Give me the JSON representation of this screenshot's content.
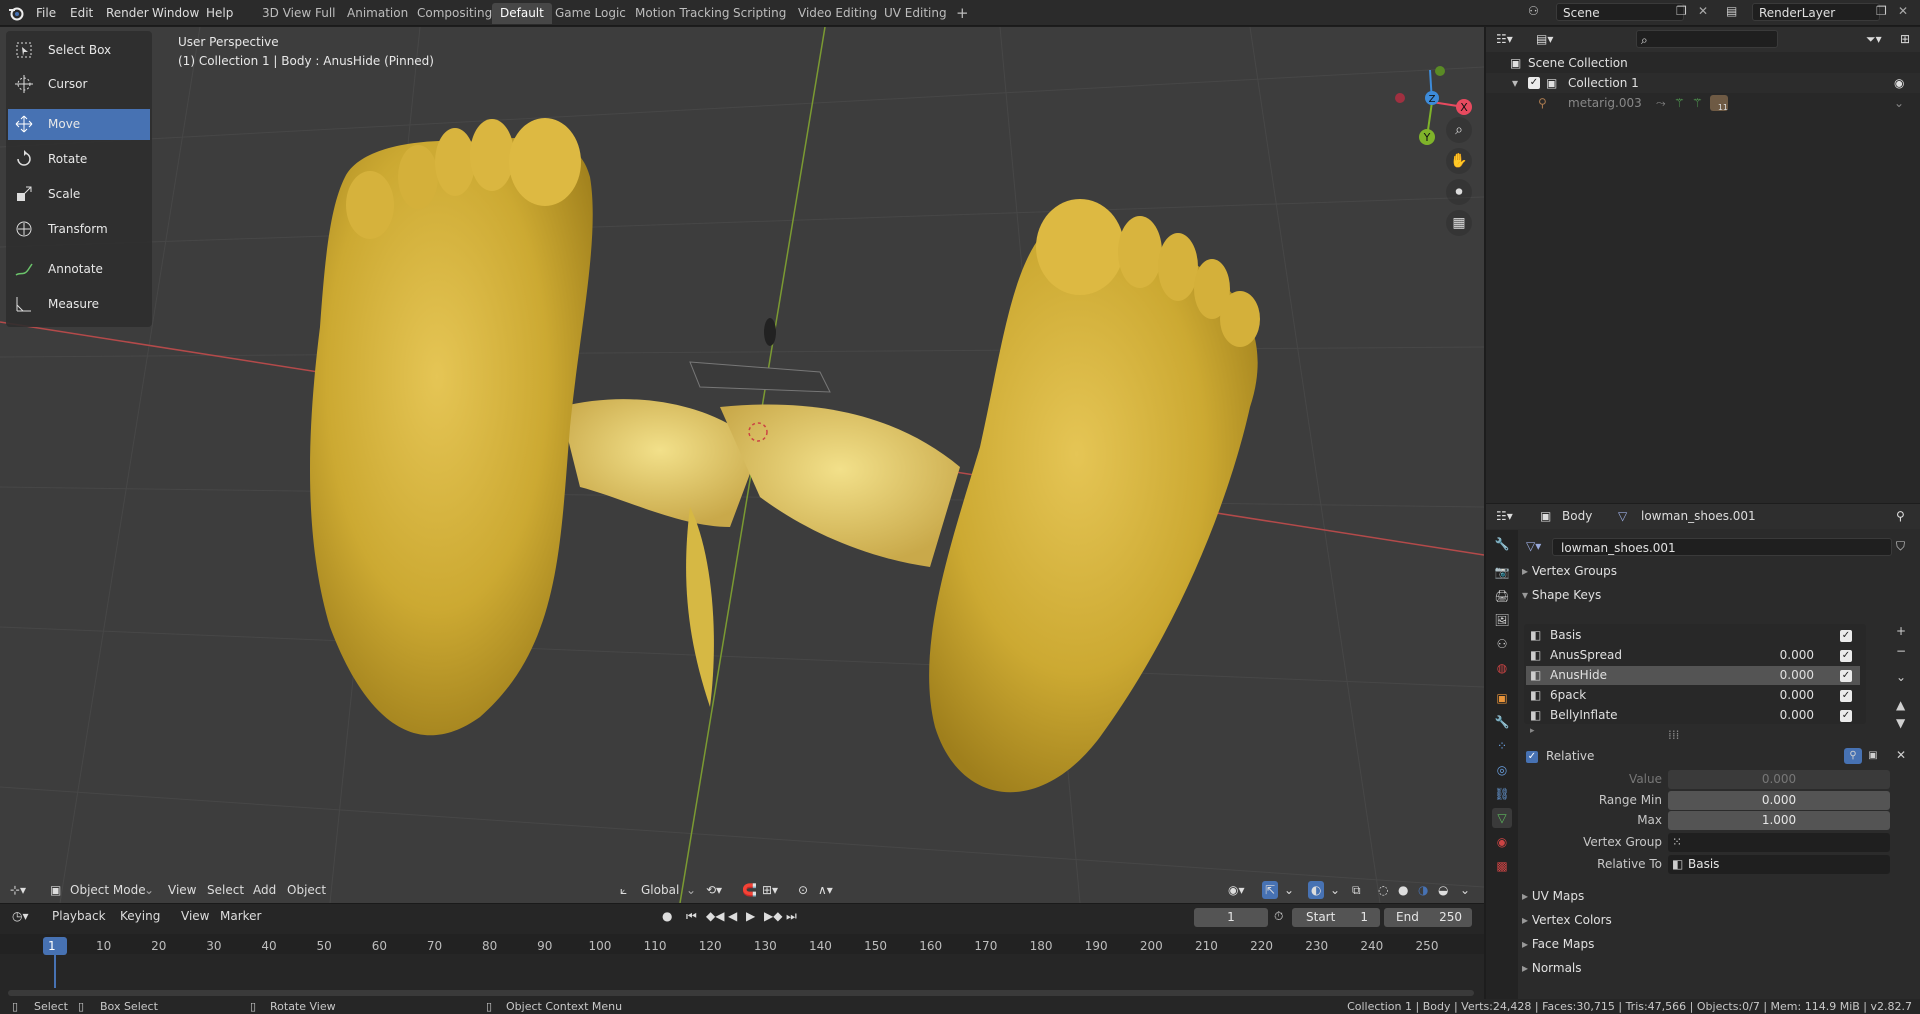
{
  "menu": {
    "file": "File",
    "edit": "Edit",
    "render": "Render",
    "window": "Window",
    "help": "Help"
  },
  "workspaces": [
    "3D View Full",
    "Animation",
    "Compositing",
    "Default",
    "Game Logic",
    "Motion Tracking",
    "Scripting",
    "Video Editing",
    "UV Editing"
  ],
  "active_workspace": "Default",
  "scene": {
    "name": "Scene",
    "render_layer": "RenderLayer"
  },
  "tools": [
    "Select Box",
    "Cursor",
    "Move",
    "Rotate",
    "Scale",
    "Transform",
    "Annotate",
    "Measure"
  ],
  "active_tool": "Move",
  "viewport": {
    "perspective": "User Perspective",
    "object_info": "(1) Collection 1 | Body : AnusHide (Pinned)",
    "header": {
      "mode": "Object Mode",
      "view": "View",
      "select": "Select",
      "add": "Add",
      "object": "Object",
      "orientation": "Global"
    },
    "gizmo": {
      "x": "X",
      "y": "Y",
      "z": "Z"
    }
  },
  "timeline": {
    "playback": "Playback",
    "keying": "Keying",
    "view": "View",
    "marker": "Marker",
    "current_frame": "1",
    "start_label": "Start",
    "start": "1",
    "end_label": "End",
    "end": "250",
    "ticks": [
      "1",
      "10",
      "20",
      "30",
      "40",
      "50",
      "60",
      "70",
      "80",
      "90",
      "100",
      "110",
      "120",
      "130",
      "140",
      "150",
      "160",
      "170",
      "180",
      "190",
      "200",
      "210",
      "220",
      "230",
      "240",
      "250"
    ]
  },
  "status": {
    "select": "Select",
    "box_select": "Box Select",
    "rotate_view": "Rotate View",
    "context_menu": "Object Context Menu",
    "stats": "Collection 1 | Body | Verts:24,428 | Faces:30,715 | Tris:47,566 | Objects:0/7 | Mem: 114.9 MiB | v2.82.7"
  },
  "outliner": {
    "scene_collection": "Scene Collection",
    "collection": "Collection 1",
    "object": "metarig.003",
    "badge": "11"
  },
  "properties": {
    "object": "Body",
    "data": "lowman_shoes.001",
    "mesh_name": "lowman_shoes.001",
    "panels": {
      "vertex_groups": "Vertex Groups",
      "shape_keys": "Shape Keys",
      "uv_maps": "UV Maps",
      "vertex_colors": "Vertex Colors",
      "face_maps": "Face Maps",
      "normals": "Normals"
    },
    "shape_keys": [
      {
        "name": "Basis",
        "value": ""
      },
      {
        "name": "AnusSpread",
        "value": "0.000"
      },
      {
        "name": "AnusHide",
        "value": "0.000"
      },
      {
        "name": "6pack",
        "value": "0.000"
      },
      {
        "name": "BellyInflate",
        "value": "0.000"
      }
    ],
    "relative_label": "Relative",
    "value_label": "Value",
    "value": "0.000",
    "range_min_label": "Range Min",
    "range_min": "0.000",
    "max_label": "Max",
    "max": "1.000",
    "vertex_group_label": "Vertex Group",
    "relative_to_label": "Relative To",
    "relative_to": "Basis"
  },
  "colors": {
    "accent": "#4772b3",
    "axis_x": "#e84a5f",
    "axis_y": "#7fb32a",
    "axis_z": "#3d8bd9",
    "mesh": "#d9b636"
  }
}
